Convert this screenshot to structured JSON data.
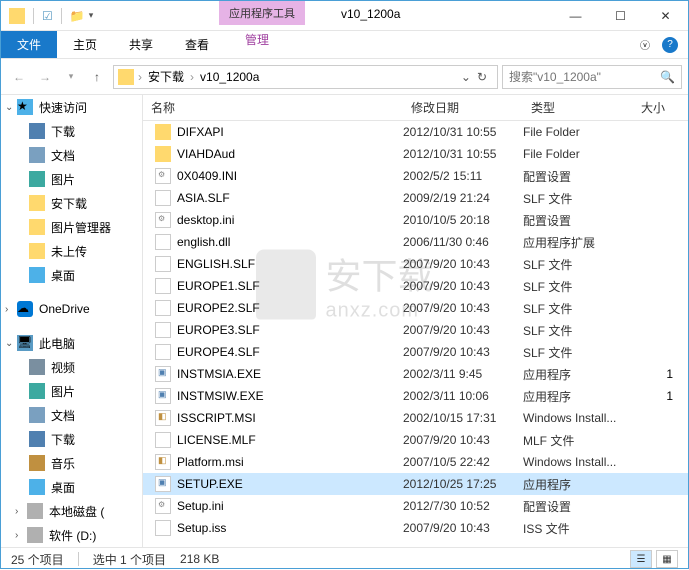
{
  "window": {
    "ribbon_context": "应用程序工具",
    "title": "v10_1200a"
  },
  "tabs": {
    "file": "文件",
    "home": "主页",
    "share": "共享",
    "view": "查看",
    "manage": "管理"
  },
  "breadcrumb": {
    "items": [
      "安下载",
      "v10_1200a"
    ]
  },
  "search": {
    "placeholder": "搜索\"v10_1200a\""
  },
  "sidebar": {
    "quick_access": "快速访问",
    "downloads": "下载",
    "documents": "文档",
    "pictures": "图片",
    "anxiazai": "安下载",
    "picmanager": "图片管理器",
    "not_uploaded": "未上传",
    "desktop": "桌面",
    "onedrive": "OneDrive",
    "this_pc": "此电脑",
    "video": "视频",
    "pictures2": "图片",
    "documents2": "文档",
    "downloads2": "下载",
    "music": "音乐",
    "desktop2": "桌面",
    "local_c": "本地磁盘 (",
    "soft_d": "软件 (D:)"
  },
  "columns": {
    "name": "名称",
    "date": "修改日期",
    "type": "类型",
    "size": "大小"
  },
  "files": [
    {
      "name": "DIFXAPI",
      "date": "2012/10/31 10:55",
      "type": "File Folder",
      "icon": "folder-y",
      "size": ""
    },
    {
      "name": "VIAHDAud",
      "date": "2012/10/31 10:55",
      "type": "File Folder",
      "icon": "folder-y",
      "size": ""
    },
    {
      "name": "0X0409.INI",
      "date": "2002/5/2 15:11",
      "type": "配置设置",
      "icon": "ini",
      "size": ""
    },
    {
      "name": "ASIA.SLF",
      "date": "2009/2/19 21:24",
      "type": "SLF 文件",
      "icon": "file",
      "size": ""
    },
    {
      "name": "desktop.ini",
      "date": "2010/10/5 20:18",
      "type": "配置设置",
      "icon": "ini",
      "size": ""
    },
    {
      "name": "english.dll",
      "date": "2006/11/30 0:46",
      "type": "应用程序扩展",
      "icon": "file",
      "size": ""
    },
    {
      "name": "ENGLISH.SLF",
      "date": "2007/9/20 10:43",
      "type": "SLF 文件",
      "icon": "file",
      "size": ""
    },
    {
      "name": "EUROPE1.SLF",
      "date": "2007/9/20 10:43",
      "type": "SLF 文件",
      "icon": "file",
      "size": ""
    },
    {
      "name": "EUROPE2.SLF",
      "date": "2007/9/20 10:43",
      "type": "SLF 文件",
      "icon": "file",
      "size": ""
    },
    {
      "name": "EUROPE3.SLF",
      "date": "2007/9/20 10:43",
      "type": "SLF 文件",
      "icon": "file",
      "size": ""
    },
    {
      "name": "EUROPE4.SLF",
      "date": "2007/9/20 10:43",
      "type": "SLF 文件",
      "icon": "file",
      "size": ""
    },
    {
      "name": "INSTMSIA.EXE",
      "date": "2002/3/11 9:45",
      "type": "应用程序",
      "icon": "exe",
      "size": "1"
    },
    {
      "name": "INSTMSIW.EXE",
      "date": "2002/3/11 10:06",
      "type": "应用程序",
      "icon": "exe",
      "size": "1"
    },
    {
      "name": "ISSCRIPT.MSI",
      "date": "2002/10/15 17:31",
      "type": "Windows Install...",
      "icon": "msi",
      "size": ""
    },
    {
      "name": "LICENSE.MLF",
      "date": "2007/9/20 10:43",
      "type": "MLF 文件",
      "icon": "file",
      "size": ""
    },
    {
      "name": "Platform.msi",
      "date": "2007/10/5 22:42",
      "type": "Windows Install...",
      "icon": "msi",
      "size": ""
    },
    {
      "name": "SETUP.EXE",
      "date": "2012/10/25 17:25",
      "type": "应用程序",
      "icon": "exe",
      "size": "",
      "selected": true
    },
    {
      "name": "Setup.ini",
      "date": "2012/7/30 10:52",
      "type": "配置设置",
      "icon": "ini",
      "size": ""
    },
    {
      "name": "Setup.iss",
      "date": "2007/9/20 10:43",
      "type": "ISS 文件",
      "icon": "file",
      "size": ""
    }
  ],
  "status": {
    "count": "25 个项目",
    "selected": "选中 1 个项目",
    "size": "218 KB"
  },
  "watermark": {
    "cn": "安下载",
    "en": "anxz.com"
  }
}
